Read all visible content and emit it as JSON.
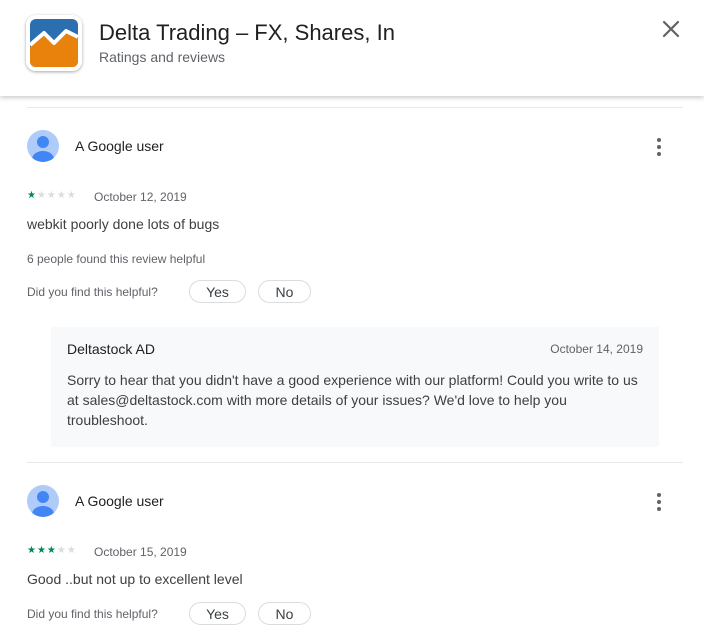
{
  "header": {
    "app_title": "Delta Trading – FX, Shares, In",
    "subtitle": "Ratings and reviews"
  },
  "reviews": [
    {
      "author": "A Google user",
      "rating": 1,
      "max_rating": 5,
      "date": "October 12, 2019",
      "text": "webkit poorly done lots of bugs",
      "helpful_count": "6 people found this review helpful",
      "helpful_question": "Did you find this helpful?",
      "yes_label": "Yes",
      "no_label": "No",
      "reply": {
        "developer": "Deltastock AD",
        "date": "October 14, 2019",
        "text": "Sorry to hear that you didn't have a good experience with our platform! Could you write to us at sales@deltastock.com with more details of your issues? We'd love to help you troubleshoot."
      }
    },
    {
      "author": "A Google user",
      "rating": 3,
      "max_rating": 5,
      "date": "October 15, 2019",
      "text": "Good ..but not up to excellent level",
      "helpful_question": "Did you find this helpful?",
      "yes_label": "Yes",
      "no_label": "No"
    }
  ],
  "colors": {
    "star_filled": "#01875f",
    "star_empty": "#dadce0",
    "avatar_bg": "#aecbfa",
    "avatar_fg": "#4285f4"
  }
}
